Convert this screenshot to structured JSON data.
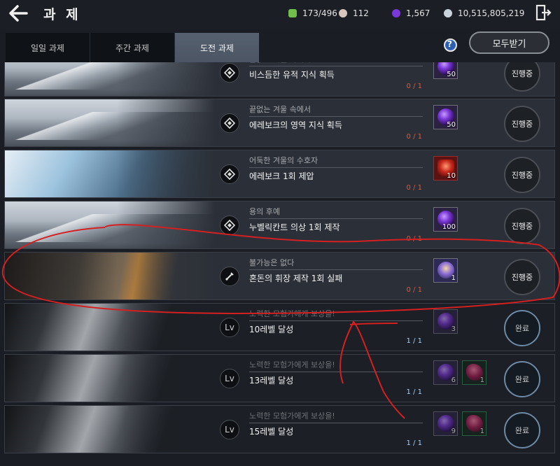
{
  "header": {
    "title": "과 제",
    "currencies": [
      {
        "icon": "green-gem-icon",
        "value": "173/496",
        "color": "#6fbf4a"
      },
      {
        "icon": "pearl-icon",
        "value": "112",
        "color": "#d7c6bd"
      },
      {
        "icon": "purple-orb-icon",
        "value": "1,567",
        "color": "#7b38d8"
      },
      {
        "icon": "silver-coin-icon",
        "value": "10,515,805,219",
        "color": "#c9d3dc"
      }
    ]
  },
  "tabs": [
    {
      "label": "일일 과제",
      "active": false
    },
    {
      "label": "주간 과제",
      "active": false
    },
    {
      "label": "도전 과제",
      "active": true
    }
  ],
  "receive_all_label": "모두받기",
  "quests": [
    {
      "sub": "끝없는 겨울 속에서",
      "main": "비스듬한 유적 지식 획득",
      "progress": "0 / 1",
      "status": "진행중",
      "done": false,
      "icon": "compass-icon",
      "banner": "mountain",
      "rewards": [
        {
          "kind": "orb",
          "qty": "50"
        }
      ]
    },
    {
      "sub": "끝없는 겨울 속에서",
      "main": "에레보크의 영역 지식 획득",
      "progress": "0 / 1",
      "status": "진행중",
      "done": false,
      "icon": "compass-icon",
      "banner": "mountain",
      "rewards": [
        {
          "kind": "orb",
          "qty": "50"
        }
      ]
    },
    {
      "sub": "어둑한 겨울의 수호자",
      "main": "에레보크 1회 제압",
      "progress": "0 / 1",
      "status": "진행중",
      "done": false,
      "icon": "compass-icon",
      "banner": "frost",
      "rewards": [
        {
          "kind": "red",
          "qty": "10"
        }
      ]
    },
    {
      "sub": "용의 후예",
      "main": "누벨릭칸트 의상 1회 제작",
      "progress": "0 / 1",
      "status": "진행중",
      "done": false,
      "icon": "compass-icon",
      "banner": "mountain",
      "rewards": [
        {
          "kind": "orb",
          "qty": "100"
        }
      ]
    },
    {
      "sub": "불가능은 없다",
      "main": "혼돈의 휘장 제작 1회 실패",
      "progress": "0 / 1",
      "status": "진행중",
      "done": false,
      "icon": "craft-icon",
      "banner": "fire",
      "rewards": [
        {
          "kind": "doll",
          "qty": "1"
        }
      ]
    },
    {
      "sub": "노력한 모험가에게 보상을!",
      "main": "10레벨 달성",
      "progress": "1 / 1",
      "status": "완료",
      "done": true,
      "icon": "level-icon",
      "icon_text": "Lv",
      "banner": "wing",
      "rewards": [
        {
          "kind": "orb",
          "qty": "3"
        }
      ]
    },
    {
      "sub": "노력한 모험가에게 보상을!",
      "main": "13레벨 달성",
      "progress": "1 / 1",
      "status": "완료",
      "done": true,
      "icon": "level-icon",
      "icon_text": "Lv",
      "banner": "wing",
      "rewards": [
        {
          "kind": "orb",
          "qty": "6"
        },
        {
          "kind": "shard",
          "qty": "1"
        }
      ]
    },
    {
      "sub": "노력한 모험가에게 보상을!",
      "main": "15레벨 달성",
      "progress": "1 / 1",
      "status": "완료",
      "done": true,
      "icon": "level-icon",
      "icon_text": "Lv",
      "banner": "wing",
      "rewards": [
        {
          "kind": "orb",
          "qty": "9"
        },
        {
          "kind": "shard",
          "qty": "1"
        }
      ]
    }
  ],
  "annotation_color": "#d42020"
}
